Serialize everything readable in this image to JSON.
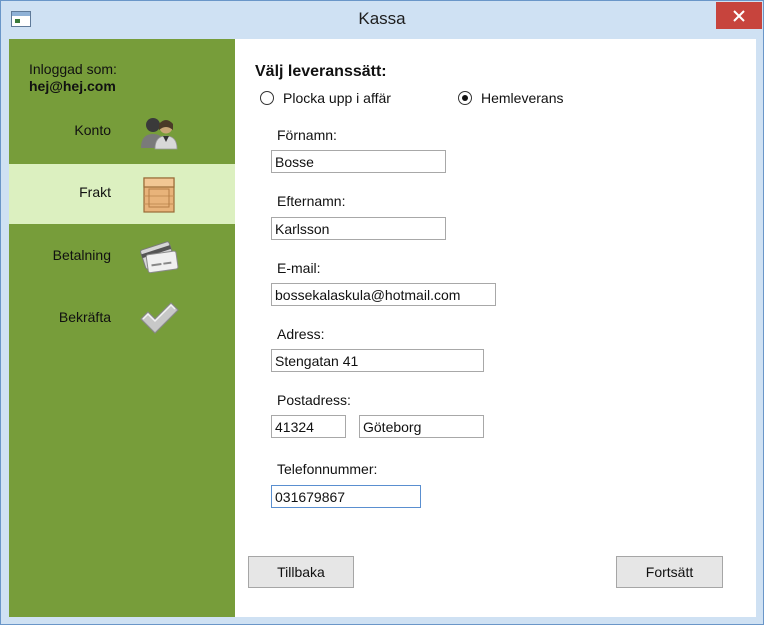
{
  "window": {
    "title": "Kassa",
    "colors": {
      "frame": "#cfe1f3",
      "close": "#c7443d",
      "sidebar": "#779d3a",
      "sidebar_active": "#dcf0c0"
    }
  },
  "sidebar": {
    "logged_in_label": "Inloggad som:",
    "user_email": "hej@hej.com",
    "items": [
      {
        "label": "Konto",
        "icon": "users-icon",
        "active": false
      },
      {
        "label": "Frakt",
        "icon": "box-icon",
        "active": true
      },
      {
        "label": "Betalning",
        "icon": "credit-card-icon",
        "active": false
      },
      {
        "label": "Bekräfta",
        "icon": "checkmark-icon",
        "active": false
      }
    ]
  },
  "form": {
    "title": "Välj leveranssätt:",
    "delivery_options": [
      {
        "label": "Plocka upp i affär",
        "checked": false
      },
      {
        "label": "Hemleverans",
        "checked": true
      }
    ],
    "fields": {
      "first_name": {
        "label": "Förnamn:",
        "value": "Bosse"
      },
      "last_name": {
        "label": "Efternamn:",
        "value": "Karlsson"
      },
      "email": {
        "label": "E-mail:",
        "value": "bossekalaskula@hotmail.com"
      },
      "address": {
        "label": "Adress:",
        "value": "Stengatan 41"
      },
      "postal": {
        "label": "Postadress:",
        "zip": "41324",
        "city": "Göteborg"
      },
      "phone": {
        "label": "Telefonnummer:",
        "value": "031679867"
      }
    }
  },
  "buttons": {
    "back": "Tillbaka",
    "next": "Fortsätt"
  }
}
